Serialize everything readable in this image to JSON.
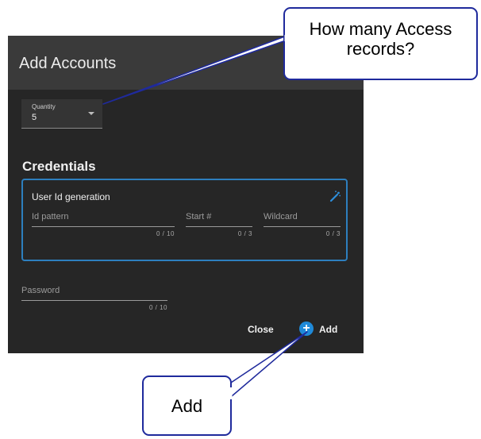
{
  "dialog": {
    "title": "Add Accounts",
    "quantity": {
      "label": "Quantity",
      "value": "5"
    },
    "credentials_title": "Credentials",
    "user_id_generation": {
      "title": "User Id generation",
      "id_pattern": {
        "label": "Id pattern",
        "counter": "0 / 10"
      },
      "start_number": {
        "label": "Start #",
        "counter": "0 / 3"
      },
      "wildcard": {
        "label": "Wildcard",
        "counter": "0 / 3"
      }
    },
    "password": {
      "label": "Password",
      "counter": "0 / 10"
    },
    "buttons": {
      "close": "Close",
      "add": "Add"
    }
  },
  "callouts": {
    "top_line1": "How many Access",
    "top_line2": "records?",
    "bottom": "Add"
  },
  "colors": {
    "accent_blue": "#1f8ad9",
    "dialog_bg": "#262626",
    "header_bg": "#3a3a3a",
    "callout_border": "#1f2a9c"
  }
}
